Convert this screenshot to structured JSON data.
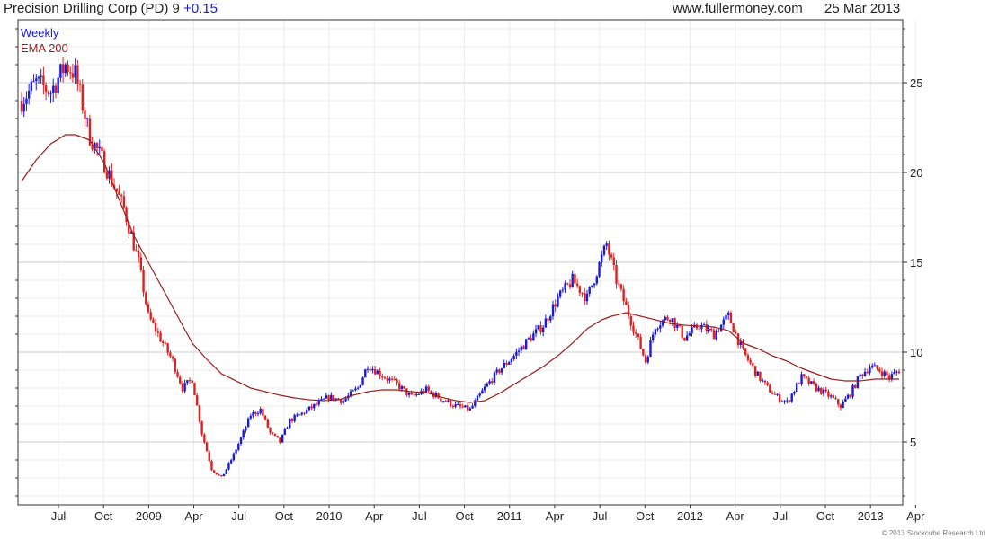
{
  "header": {
    "title": "Precision Drilling Corp (PD) 9",
    "change": "+0.15",
    "site": "www.fullermoney.com",
    "date": "25 Mar 2013"
  },
  "legend": {
    "weekly": "Weekly",
    "ema": "EMA 200"
  },
  "copyright": "© 2013 Stockcube Research Ltd",
  "colors": {
    "up": "#1a1adb",
    "down": "#e02020",
    "ema": "#9b1c1c",
    "legend_weekly": "#1a1adb",
    "legend_ema": "#9b1c1c",
    "grid": "#cfcfcf",
    "grid_minor": "#ececec"
  },
  "chart_data": {
    "type": "candlestick",
    "timeframe": "weekly",
    "x_ticks": [
      "Jul",
      "Oct",
      "2009",
      "Apr",
      "Jul",
      "Oct",
      "2010",
      "Apr",
      "Jul",
      "Oct",
      "2011",
      "Apr",
      "Jul",
      "Oct",
      "2012",
      "Apr",
      "Jul",
      "Oct",
      "2013",
      "Apr"
    ],
    "y_ticks": [
      5,
      10,
      15,
      20,
      25
    ],
    "ylim": [
      1.5,
      28.5
    ],
    "price_path": [
      [
        0,
        24.0
      ],
      [
        6,
        25.0
      ],
      [
        12,
        24.5
      ],
      [
        18,
        26.0
      ],
      [
        22,
        25.5
      ],
      [
        28,
        22.0
      ],
      [
        34,
        20.5
      ],
      [
        42,
        18.0
      ],
      [
        48,
        15.0
      ],
      [
        52,
        12.0
      ],
      [
        58,
        10.5
      ],
      [
        62,
        9.5
      ],
      [
        66,
        8.0
      ],
      [
        70,
        8.5
      ],
      [
        74,
        5.5
      ],
      [
        78,
        3.5
      ],
      [
        82,
        3.0
      ],
      [
        86,
        4.0
      ],
      [
        90,
        5.2
      ],
      [
        94,
        6.5
      ],
      [
        98,
        6.8
      ],
      [
        102,
        5.5
      ],
      [
        106,
        5.0
      ],
      [
        110,
        6.2
      ],
      [
        114,
        6.5
      ],
      [
        120,
        7.0
      ],
      [
        126,
        7.5
      ],
      [
        132,
        7.3
      ],
      [
        138,
        8.0
      ],
      [
        142,
        9.3
      ],
      [
        148,
        8.7
      ],
      [
        154,
        8.2
      ],
      [
        160,
        7.5
      ],
      [
        166,
        7.9
      ],
      [
        172,
        7.4
      ],
      [
        178,
        7.0
      ],
      [
        184,
        6.8
      ],
      [
        190,
        8.0
      ],
      [
        196,
        9.0
      ],
      [
        202,
        9.8
      ],
      [
        208,
        10.7
      ],
      [
        214,
        11.5
      ],
      [
        220,
        13.0
      ],
      [
        226,
        14.0
      ],
      [
        232,
        13.0
      ],
      [
        236,
        14.5
      ],
      [
        240,
        16.0
      ],
      [
        244,
        14.0
      ],
      [
        248,
        12.5
      ],
      [
        252,
        11.0
      ],
      [
        256,
        9.5
      ],
      [
        260,
        11.5
      ],
      [
        266,
        12.0
      ],
      [
        272,
        10.8
      ],
      [
        278,
        11.5
      ],
      [
        284,
        11.0
      ],
      [
        290,
        12.0
      ],
      [
        296,
        10.0
      ],
      [
        302,
        8.7
      ],
      [
        306,
        8.0
      ],
      [
        310,
        7.5
      ],
      [
        314,
        7.2
      ],
      [
        320,
        8.6
      ],
      [
        326,
        8.0
      ],
      [
        332,
        7.5
      ],
      [
        336,
        7.0
      ],
      [
        340,
        7.7
      ],
      [
        344,
        8.7
      ],
      [
        348,
        9.2
      ],
      [
        352,
        9.0
      ],
      [
        356,
        8.6
      ],
      [
        360,
        9.0
      ]
    ],
    "ema_200": [
      [
        0,
        19.5
      ],
      [
        6,
        20.7
      ],
      [
        12,
        21.6
      ],
      [
        18,
        22.1
      ],
      [
        22,
        22.1
      ],
      [
        28,
        21.8
      ],
      [
        34,
        20.5
      ],
      [
        40,
        18.5
      ],
      [
        46,
        16.5
      ],
      [
        52,
        15.0
      ],
      [
        58,
        13.5
      ],
      [
        64,
        12.0
      ],
      [
        70,
        10.5
      ],
      [
        76,
        9.6
      ],
      [
        82,
        8.8
      ],
      [
        88,
        8.4
      ],
      [
        94,
        8.0
      ],
      [
        100,
        7.8
      ],
      [
        106,
        7.6
      ],
      [
        112,
        7.45
      ],
      [
        118,
        7.35
      ],
      [
        124,
        7.3
      ],
      [
        130,
        7.35
      ],
      [
        136,
        7.6
      ],
      [
        142,
        7.8
      ],
      [
        148,
        7.9
      ],
      [
        154,
        7.9
      ],
      [
        160,
        7.8
      ],
      [
        166,
        7.75
      ],
      [
        172,
        7.5
      ],
      [
        178,
        7.3
      ],
      [
        184,
        7.2
      ],
      [
        190,
        7.3
      ],
      [
        196,
        7.7
      ],
      [
        202,
        8.2
      ],
      [
        208,
        8.7
      ],
      [
        214,
        9.2
      ],
      [
        220,
        9.8
      ],
      [
        226,
        10.5
      ],
      [
        232,
        11.3
      ],
      [
        238,
        11.8
      ],
      [
        242,
        12.0
      ],
      [
        248,
        12.2
      ],
      [
        254,
        12.0
      ],
      [
        260,
        11.8
      ],
      [
        266,
        11.6
      ],
      [
        272,
        11.5
      ],
      [
        278,
        11.45
      ],
      [
        284,
        11.4
      ],
      [
        290,
        11.2
      ],
      [
        296,
        10.5
      ],
      [
        302,
        10.2
      ],
      [
        308,
        9.8
      ],
      [
        314,
        9.5
      ],
      [
        320,
        9.1
      ],
      [
        326,
        8.8
      ],
      [
        332,
        8.5
      ],
      [
        338,
        8.4
      ],
      [
        344,
        8.4
      ],
      [
        350,
        8.5
      ],
      [
        356,
        8.5
      ],
      [
        360,
        8.5
      ]
    ]
  }
}
